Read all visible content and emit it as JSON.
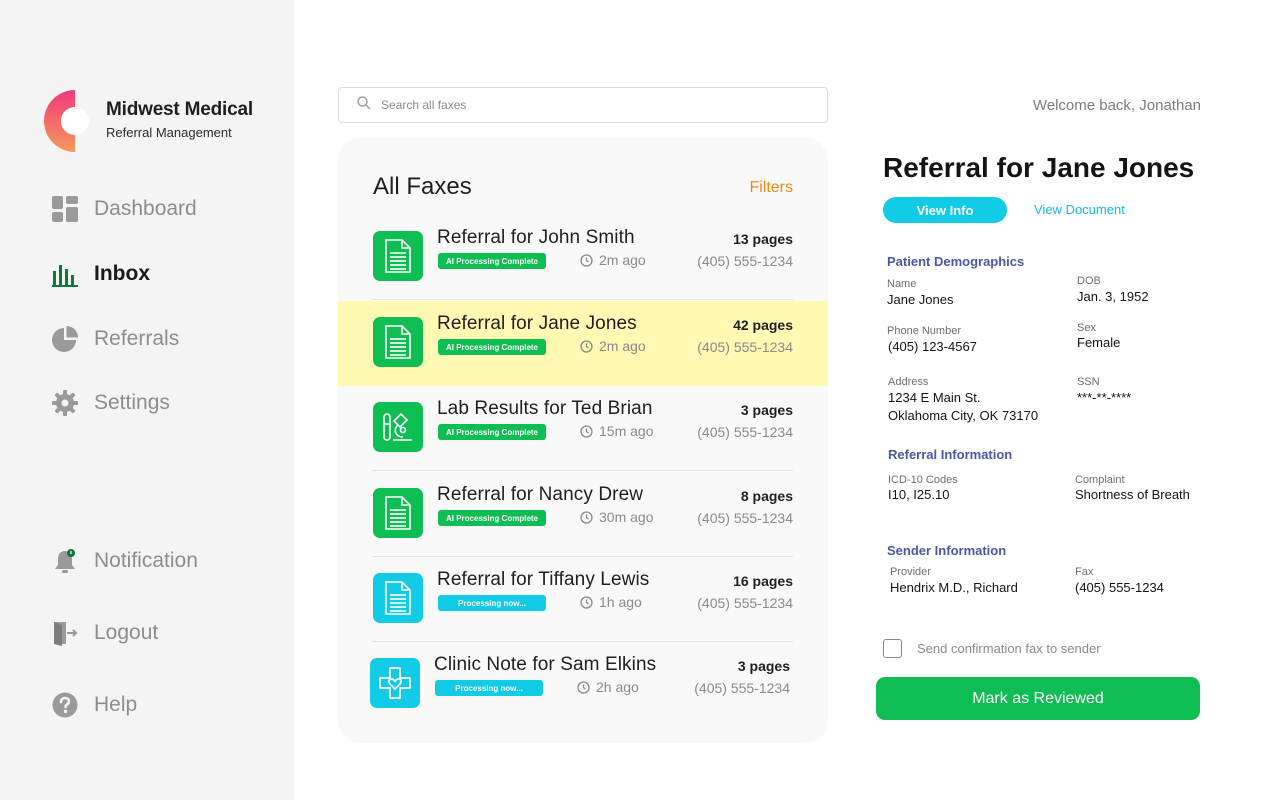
{
  "brand": {
    "name": "Midwest Medical",
    "subtitle": "Referral Management"
  },
  "nav": {
    "dashboard": "Dashboard",
    "inbox": "Inbox",
    "referrals": "Referrals",
    "settings": "Settings",
    "notification": "Notification",
    "logout": "Logout",
    "help": "Help"
  },
  "search": {
    "placeholder": "Search all faxes"
  },
  "faxes": {
    "title": "All Faxes",
    "filters_label": "Filters",
    "items": [
      {
        "title": "Referral for John Smith",
        "status": "AI Processing Complete",
        "time": "2m ago",
        "pages": "13 pages",
        "phone": "(405) 555-1234",
        "icon": "document-icon"
      },
      {
        "title": "Referral for Jane Jones",
        "status": "AI Processing Complete",
        "time": "2m ago",
        "pages": "42 pages",
        "phone": "(405) 555-1234",
        "icon": "document-icon"
      },
      {
        "title": "Lab Results for Ted Brian",
        "status": "AI Processing Complete",
        "time": "15m ago",
        "pages": "3 pages",
        "phone": "(405) 555-1234",
        "icon": "lab-microscope-icon"
      },
      {
        "title": "Referral for Nancy Drew",
        "status": "AI Processing Complete",
        "time": "30m ago",
        "pages": "8 pages",
        "phone": "(405) 555-1234",
        "icon": "document-icon"
      },
      {
        "title": "Referral for Tiffany Lewis",
        "status": "Processing now...",
        "time": "1h ago",
        "pages": "16 pages",
        "phone": "(405) 555-1234",
        "icon": "document-icon"
      },
      {
        "title": "Clinic Note for Sam Elkins",
        "status": "Processing now...",
        "time": "2h ago",
        "pages": "3 pages",
        "phone": "(405) 555-1234",
        "icon": "medical-cross-heart-icon"
      }
    ]
  },
  "header": {
    "welcome": "Welcome back, Jonathan"
  },
  "detail": {
    "title": "Referral for Jane Jones",
    "tab_info": "View Info",
    "tab_document": "View Document",
    "demographics": {
      "heading": "Patient Demographics",
      "name_label": "Name",
      "name": "Jane Jones",
      "dob_label": "DOB",
      "dob": "Jan. 3, 1952",
      "phone_label": "Phone Number",
      "phone": "(405) 123-4567",
      "sex_label": "Sex",
      "sex": "Female",
      "address_label": "Address",
      "address_line1": "1234 E Main St.",
      "address_line2": "Oklahoma City, OK 73170",
      "ssn_label": "SSN",
      "ssn": "***-**-****"
    },
    "referral": {
      "heading": "Referral Information",
      "icd_label": "ICD-10 Codes",
      "icd": "I10, I25.10",
      "complaint_label": "Complaint",
      "complaint": "Shortness of Breath"
    },
    "sender": {
      "heading": "Sender Information",
      "provider_label": "Provider",
      "provider": "Hendrix M.D., Richard",
      "fax_label": "Fax",
      "fax": "(405) 555-1234"
    },
    "confirm_label": "Send confirmation fax to sender",
    "mark_reviewed": "Mark as Reviewed"
  },
  "colors": {
    "accent_green": "#0fbe52",
    "accent_cyan": "#12cbe6",
    "filters_orange": "#f08a16",
    "selected_row": "#fff9b3",
    "section_heading": "#4b56a6"
  }
}
